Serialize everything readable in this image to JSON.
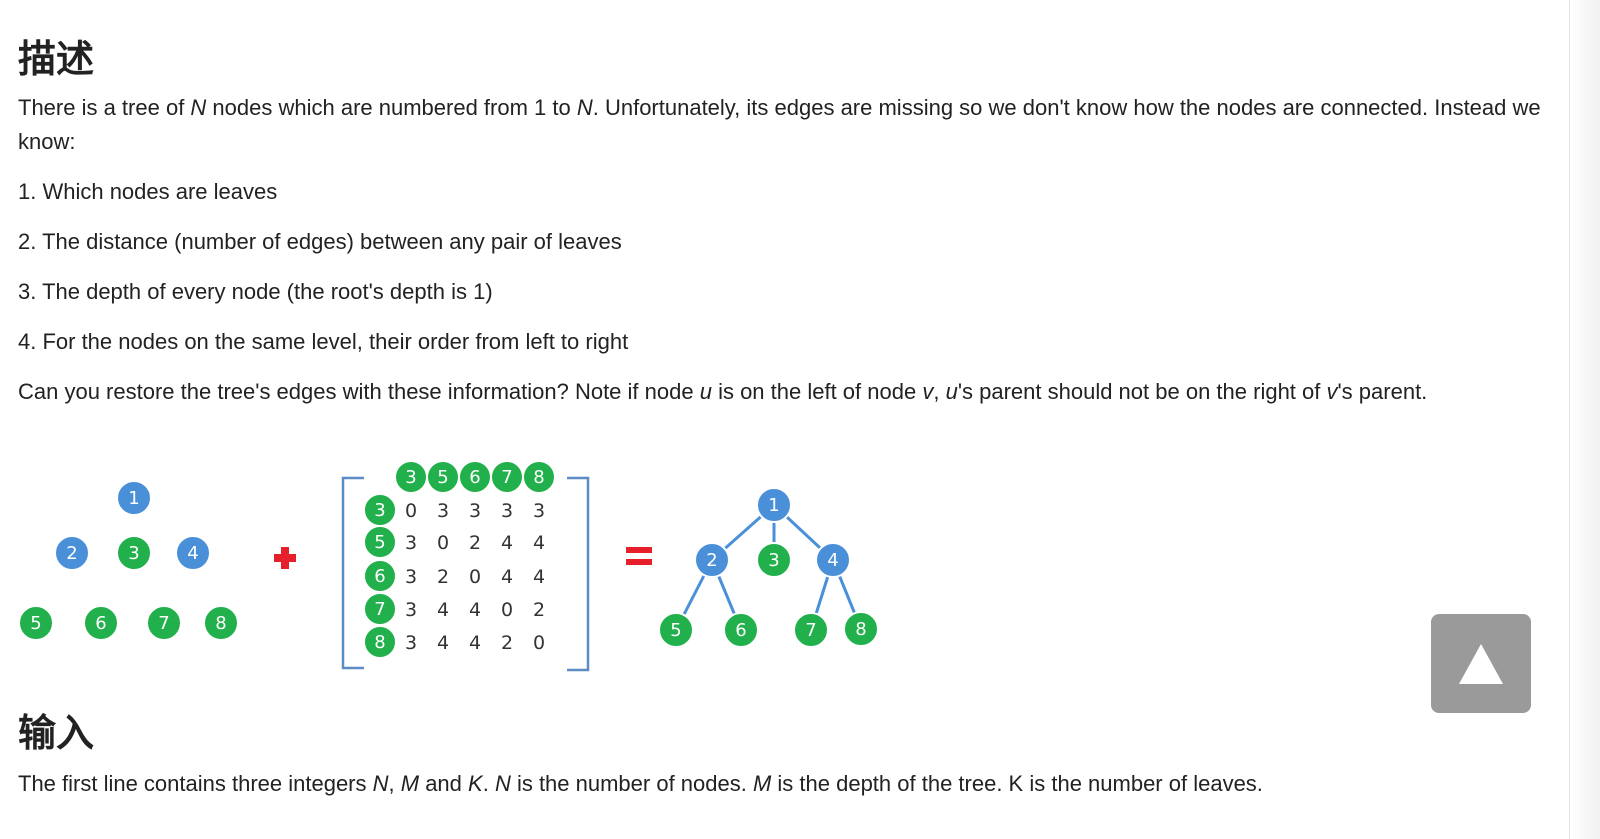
{
  "section_description": {
    "heading": "描述"
  },
  "intro": {
    "part1": "There is a tree of ",
    "var_n1": "N",
    "part2": " nodes which are numbered from 1 to ",
    "var_n2": "N",
    "part3": ". Unfortunately, its edges are missing so we don't know how the nodes are connected. Instead we know:"
  },
  "facts": [
    "1. Which nodes are leaves",
    "2. The distance (number of edges) between any pair of leaves",
    "3. The depth of every node (the root's depth is 1)",
    "4. For the nodes on the same level, their order from left to right"
  ],
  "question": {
    "part1": "Can you restore the tree's edges with these information? Note if node ",
    "var_u1": "u",
    "part2": " is on the left of node ",
    "var_v1": "v",
    "part3": ", ",
    "var_u2": "u",
    "part4": "'s parent should not be on the right of ",
    "var_v2": "v",
    "part5": "'s parent."
  },
  "figure": {
    "colors": {
      "internal_node": "#4a90d9",
      "leaf_node": "#21b04b",
      "operator": "#e5202a",
      "matrix_bracket": "#5b8cc5",
      "node_border": "#ffffff"
    },
    "levels_diagram": {
      "level_1": [
        "1"
      ],
      "level_2": [
        "2",
        "3",
        "4"
      ],
      "level_3": [
        "5",
        "6",
        "7",
        "8"
      ]
    },
    "plus_symbol": "plus-icon",
    "distance_matrix": {
      "leaves": [
        "3",
        "5",
        "6",
        "7",
        "8"
      ],
      "rows": [
        [
          0,
          3,
          3,
          3,
          3
        ],
        [
          3,
          0,
          2,
          4,
          4
        ],
        [
          3,
          2,
          0,
          4,
          4
        ],
        [
          3,
          4,
          4,
          0,
          2
        ],
        [
          3,
          4,
          4,
          2,
          0
        ]
      ]
    },
    "equals_symbol": "equals-icon",
    "result_tree": {
      "nodes": [
        "1",
        "2",
        "3",
        "4",
        "5",
        "6",
        "7",
        "8"
      ],
      "edges": [
        [
          "1",
          "2"
        ],
        [
          "1",
          "3"
        ],
        [
          "1",
          "4"
        ],
        [
          "2",
          "5"
        ],
        [
          "2",
          "6"
        ],
        [
          "4",
          "7"
        ],
        [
          "4",
          "8"
        ]
      ]
    }
  },
  "section_input": {
    "heading": "输入"
  },
  "input_text": {
    "part1": "The first line contains three integers ",
    "var_n": "N",
    "part2": ", ",
    "var_m": "M",
    "part3": " and ",
    "var_k": "K",
    "part4": ". ",
    "var_n2": "N",
    "part5": " is the number of nodes. ",
    "var_m2": "M",
    "part6": " is the depth of the tree. K is the number of leaves."
  },
  "back_to_top": {
    "icon": "triangle-up-icon"
  }
}
